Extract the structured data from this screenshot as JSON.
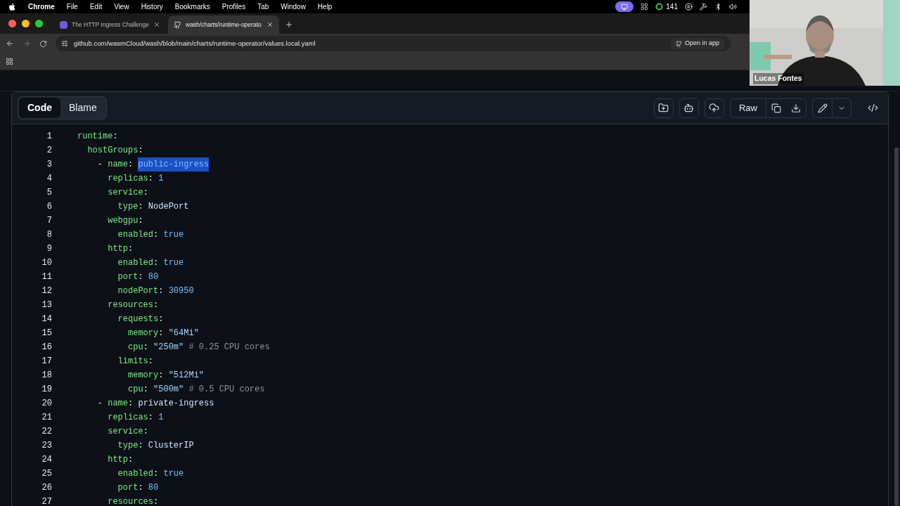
{
  "menu_bar": {
    "app": "Chrome",
    "items": [
      "File",
      "Edit",
      "View",
      "History",
      "Bookmarks",
      "Profiles",
      "Tab",
      "Window",
      "Help"
    ],
    "status_count": "141"
  },
  "tabs": [
    {
      "title": "The HTTP Ingress Challenge",
      "selected": false
    },
    {
      "title": "wash/charts/runtime-operato",
      "selected": true
    }
  ],
  "address_bar": {
    "url": "github.com/wasmCloud/wash/blob/main/charts/runtime-operator/values.local.yaml",
    "open_in_app": "Open in app"
  },
  "video_overlay": {
    "kind": "picture",
    "name": "Lucas Fontes"
  },
  "file_view": {
    "view_tabs": [
      {
        "label": "Code",
        "selected": true
      },
      {
        "label": "Blame",
        "selected": false
      }
    ],
    "raw_button": "Raw",
    "lines": [
      {
        "number": "1",
        "tokens": [
          {
            "kind": "key",
            "text": "runtime"
          },
          {
            "kind": "punct",
            "text": ":"
          }
        ]
      },
      {
        "number": "2",
        "tokens": [
          {
            "kind": "key",
            "text": "  hostGroups"
          },
          {
            "kind": "punct",
            "text": ":"
          }
        ]
      },
      {
        "number": "3",
        "tokens": [
          {
            "kind": "punct",
            "text": "    - "
          },
          {
            "kind": "key",
            "text": "name"
          },
          {
            "kind": "punct",
            "text": ": "
          },
          {
            "kind": "selected",
            "text": "public-ingress"
          }
        ]
      },
      {
        "number": "4",
        "tokens": [
          {
            "kind": "key",
            "text": "      replicas"
          },
          {
            "kind": "punct",
            "text": ": "
          },
          {
            "kind": "number",
            "text": "1"
          }
        ]
      },
      {
        "number": "5",
        "tokens": [
          {
            "kind": "key",
            "text": "      service"
          },
          {
            "kind": "punct",
            "text": ":"
          }
        ]
      },
      {
        "number": "6",
        "tokens": [
          {
            "kind": "key",
            "text": "        type"
          },
          {
            "kind": "punct",
            "text": ": "
          },
          {
            "kind": "value",
            "text": "NodePort"
          }
        ]
      },
      {
        "number": "7",
        "tokens": [
          {
            "kind": "key",
            "text": "      webgpu"
          },
          {
            "kind": "punct",
            "text": ":"
          }
        ]
      },
      {
        "number": "8",
        "tokens": [
          {
            "kind": "key",
            "text": "        enabled"
          },
          {
            "kind": "punct",
            "text": ": "
          },
          {
            "kind": "number",
            "text": "true"
          }
        ]
      },
      {
        "number": "9",
        "tokens": [
          {
            "kind": "key",
            "text": "      http"
          },
          {
            "kind": "punct",
            "text": ":"
          }
        ]
      },
      {
        "number": "10",
        "tokens": [
          {
            "kind": "key",
            "text": "        enabled"
          },
          {
            "kind": "punct",
            "text": ": "
          },
          {
            "kind": "number",
            "text": "true"
          }
        ]
      },
      {
        "number": "11",
        "tokens": [
          {
            "kind": "key",
            "text": "        port"
          },
          {
            "kind": "punct",
            "text": ": "
          },
          {
            "kind": "number",
            "text": "80"
          }
        ]
      },
      {
        "number": "12",
        "tokens": [
          {
            "kind": "key",
            "text": "        nodePort"
          },
          {
            "kind": "punct",
            "text": ": "
          },
          {
            "kind": "number",
            "text": "30950"
          }
        ]
      },
      {
        "number": "13",
        "tokens": [
          {
            "kind": "key",
            "text": "      resources"
          },
          {
            "kind": "punct",
            "text": ":"
          }
        ]
      },
      {
        "number": "14",
        "tokens": [
          {
            "kind": "key",
            "text": "        requests"
          },
          {
            "kind": "punct",
            "text": ":"
          }
        ]
      },
      {
        "number": "15",
        "tokens": [
          {
            "kind": "key",
            "text": "          memory"
          },
          {
            "kind": "punct",
            "text": ": "
          },
          {
            "kind": "string",
            "text": "\"64Mi\""
          }
        ]
      },
      {
        "number": "16",
        "tokens": [
          {
            "kind": "key",
            "text": "          cpu"
          },
          {
            "kind": "punct",
            "text": ": "
          },
          {
            "kind": "string",
            "text": "\"250m\""
          },
          {
            "kind": "comment",
            "text": " # 0.25 CPU cores"
          }
        ]
      },
      {
        "number": "17",
        "tokens": [
          {
            "kind": "key",
            "text": "        limits"
          },
          {
            "kind": "punct",
            "text": ":"
          }
        ]
      },
      {
        "number": "18",
        "tokens": [
          {
            "kind": "key",
            "text": "          memory"
          },
          {
            "kind": "punct",
            "text": ": "
          },
          {
            "kind": "string",
            "text": "\"512Mi\""
          }
        ]
      },
      {
        "number": "19",
        "tokens": [
          {
            "kind": "key",
            "text": "          cpu"
          },
          {
            "kind": "punct",
            "text": ": "
          },
          {
            "kind": "string",
            "text": "\"500m\""
          },
          {
            "kind": "comment",
            "text": " # 0.5 CPU cores"
          }
        ]
      },
      {
        "number": "20",
        "tokens": [
          {
            "kind": "punct",
            "text": "    - "
          },
          {
            "kind": "key",
            "text": "name"
          },
          {
            "kind": "punct",
            "text": ": "
          },
          {
            "kind": "value",
            "text": "private-ingress"
          }
        ]
      },
      {
        "number": "21",
        "tokens": [
          {
            "kind": "key",
            "text": "      replicas"
          },
          {
            "kind": "punct",
            "text": ": "
          },
          {
            "kind": "number",
            "text": "1"
          }
        ]
      },
      {
        "number": "22",
        "tokens": [
          {
            "kind": "key",
            "text": "      service"
          },
          {
            "kind": "punct",
            "text": ":"
          }
        ]
      },
      {
        "number": "23",
        "tokens": [
          {
            "kind": "key",
            "text": "        type"
          },
          {
            "kind": "punct",
            "text": ": "
          },
          {
            "kind": "value",
            "text": "ClusterIP"
          }
        ]
      },
      {
        "number": "24",
        "tokens": [
          {
            "kind": "key",
            "text": "      http"
          },
          {
            "kind": "punct",
            "text": ":"
          }
        ]
      },
      {
        "number": "25",
        "tokens": [
          {
            "kind": "key",
            "text": "        enabled"
          },
          {
            "kind": "punct",
            "text": ": "
          },
          {
            "kind": "number",
            "text": "true"
          }
        ]
      },
      {
        "number": "26",
        "tokens": [
          {
            "kind": "key",
            "text": "        port"
          },
          {
            "kind": "punct",
            "text": ": "
          },
          {
            "kind": "number",
            "text": "80"
          }
        ]
      },
      {
        "number": "27",
        "tokens": [
          {
            "kind": "key",
            "text": "      resources"
          },
          {
            "kind": "punct",
            "text": ":"
          }
        ]
      }
    ]
  }
}
